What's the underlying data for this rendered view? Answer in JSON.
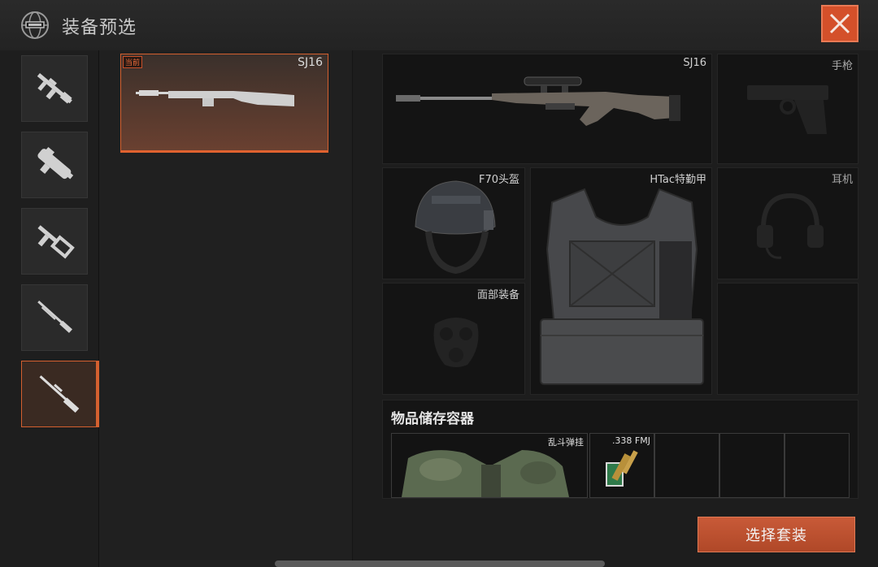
{
  "header": {
    "title": "装备预选",
    "icon": "globe-icon",
    "close_icon": "close-icon",
    "accent": "#d4602f"
  },
  "weapon_tabs": [
    {
      "icon": "assault-rifle-icon"
    },
    {
      "icon": "smg-icon"
    },
    {
      "icon": "vector-smg-icon"
    },
    {
      "icon": "shotgun-icon"
    },
    {
      "icon": "sniper-rifle-icon",
      "active": true
    }
  ],
  "loadout": {
    "badge": "当前",
    "name": "SJ16"
  },
  "slots": {
    "primary": "SJ16",
    "pistol": "手枪",
    "helmet": "F70头盔",
    "armor": "HTac特勤甲",
    "headset": "耳机",
    "face": "面部装备"
  },
  "storage": {
    "title": "物品储存容器",
    "rig": "乱斗弹挂",
    "ammo": ".338 FMJ"
  },
  "select_button": "选择套装"
}
